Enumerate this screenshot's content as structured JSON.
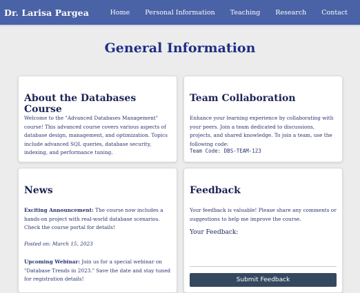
{
  "nav": {
    "brand": "Dr. Larisa Pargea",
    "links": [
      "Home",
      "Personal Information",
      "Teaching",
      "Research",
      "Contact"
    ]
  },
  "page_title": "General Information",
  "about": {
    "title": "About the Databases Course",
    "text": "Welcome to the \"Advanced Databases Management\" course! This advanced course covers various aspects of database design, management, and optimization. Topics include advanced SQL queries, database security, indexing, and performance tuning."
  },
  "team": {
    "title": "Team Collaboration",
    "text": "Enhance your learning experience by collaborating with your peers. Join a team dedicated to discussions, projects, and shared knowledge. To join a team, use the following code:",
    "code_label": "Team Code:",
    "code_value": "DBS-TEAM-123"
  },
  "news": {
    "title": "News",
    "item1_label": "Exciting Announcement:",
    "item1_text": "The course now includes a hands-on project with real-world database scenarios. Check the course portal for details!",
    "item1_date": "Posted on: March 15, 2023",
    "item2_label": "Upcoming Webinar:",
    "item2_text": "Join us for a special webinar on \"Database Trends in 2023.\" Save the date and stay tuned for registration details!"
  },
  "feedback": {
    "title": "Feedback",
    "text": "Your feedback is valuable! Please share any comments or suggestions to help me improve the course.",
    "field_label": "Your Feedback:",
    "submit_label": "Submit Feedback"
  }
}
